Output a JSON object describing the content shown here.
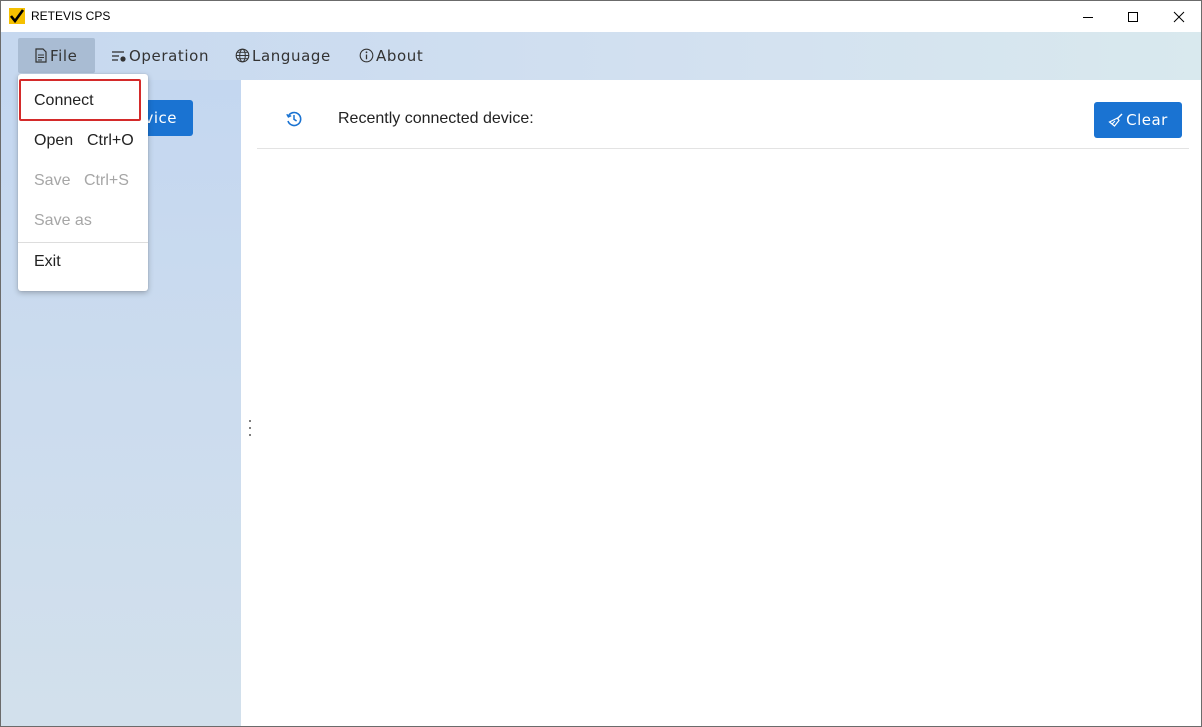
{
  "window": {
    "title": "RETEVIS CPS"
  },
  "menubar": {
    "items": [
      {
        "label": "File",
        "icon": "file-icon"
      },
      {
        "label": "Operation",
        "icon": "operation-icon"
      },
      {
        "label": "Language",
        "icon": "globe-icon"
      },
      {
        "label": "About",
        "icon": "info-icon"
      }
    ]
  },
  "file_menu": {
    "items": [
      {
        "label": "Connect",
        "shortcut": "",
        "enabled": true
      },
      {
        "label": "Open",
        "shortcut": "Ctrl+O",
        "enabled": true
      },
      {
        "label": "Save",
        "shortcut": "Ctrl+S",
        "enabled": false
      },
      {
        "label": "Save as",
        "shortcut": "",
        "enabled": false
      },
      {
        "label": "Exit",
        "shortcut": "",
        "enabled": true
      }
    ]
  },
  "sidebar": {
    "button_label": "vice"
  },
  "main": {
    "recent_label": "Recently connected device:",
    "clear_label": "Clear"
  },
  "colors": {
    "accent": "#1a73d2",
    "highlight_border": "#d42a2a",
    "menubar_active": "#a9bcd3"
  }
}
